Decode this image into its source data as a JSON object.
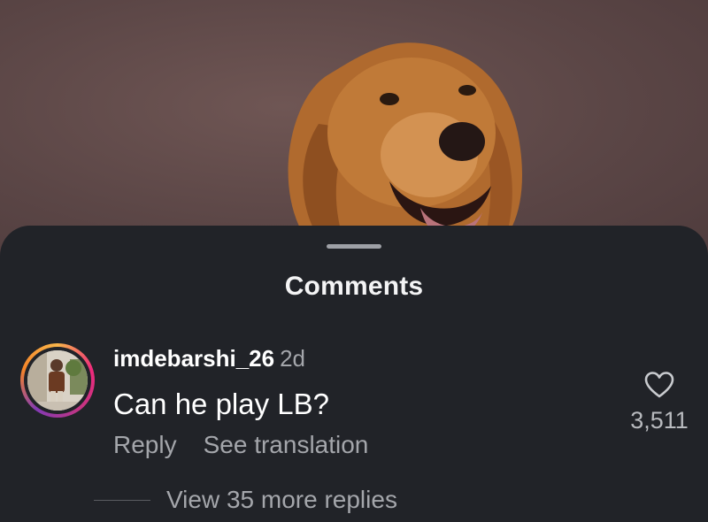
{
  "sheet": {
    "title": "Comments"
  },
  "comment": {
    "username": "imdebarshi_26",
    "time": "2d",
    "text": "Can he play LB?",
    "reply_label": "Reply",
    "translate_label": "See translation",
    "likes": "3,511",
    "view_replies": "View 35 more replies"
  },
  "colors": {
    "sheet_bg": "#212328",
    "secondary_text": "#a4a6ab",
    "primary_text": "#ffffff"
  },
  "icons": {
    "like": "heart-outline-icon",
    "handle": "drag-handle"
  }
}
